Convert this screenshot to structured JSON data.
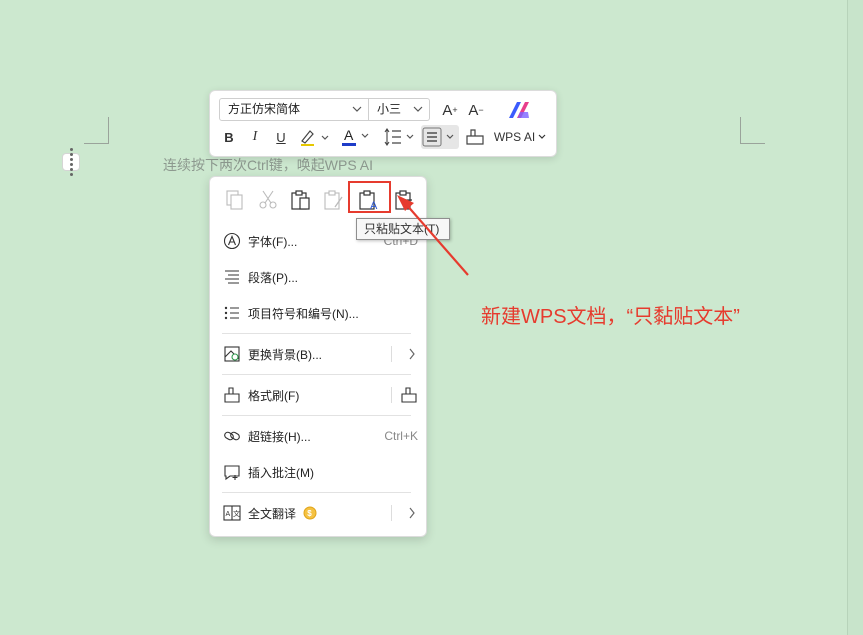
{
  "editor": {
    "hint_text": "连续按下两次Ctrl键，唤起WPS AI"
  },
  "toolbar": {
    "font_name": "方正仿宋简体",
    "font_size": "小三",
    "grow_label": "A",
    "shrink_label": "A",
    "bold_label": "B",
    "italic_label": "I",
    "underline_label": "U",
    "font_color_label": "A",
    "font_color": "#1e3cc8",
    "wps_ai_label": "WPS AI"
  },
  "context_menu": {
    "paste_icons": [
      "copy-icon",
      "cut-icon",
      "paste-icon",
      "paste-format-icon",
      "paste-text-only-icon",
      "paste-special-icon"
    ],
    "items": [
      {
        "label": "字体(F)...",
        "shortcut": "Ctrl+D",
        "icon": "font-icon"
      },
      {
        "label": "段落(P)...",
        "icon": "paragraph-icon"
      },
      {
        "label": "项目符号和编号(N)...",
        "icon": "bullet-list-icon"
      },
      {
        "label": "更换背景(B)...",
        "icon": "background-icon",
        "submenu": true
      },
      {
        "label": "格式刷(F)",
        "icon": "format-painter-icon"
      },
      {
        "label": "超链接(H)...",
        "shortcut": "Ctrl+K",
        "icon": "link-icon"
      },
      {
        "label": "插入批注(M)",
        "icon": "comment-icon"
      },
      {
        "label": "全文翻译",
        "icon": "translate-icon",
        "submenu": true
      }
    ]
  },
  "tooltip": {
    "text": "只粘贴文本(T)"
  },
  "annotation": {
    "text": "新建WPS文档，“只黏贴文本”",
    "color": "#e63b2e"
  }
}
